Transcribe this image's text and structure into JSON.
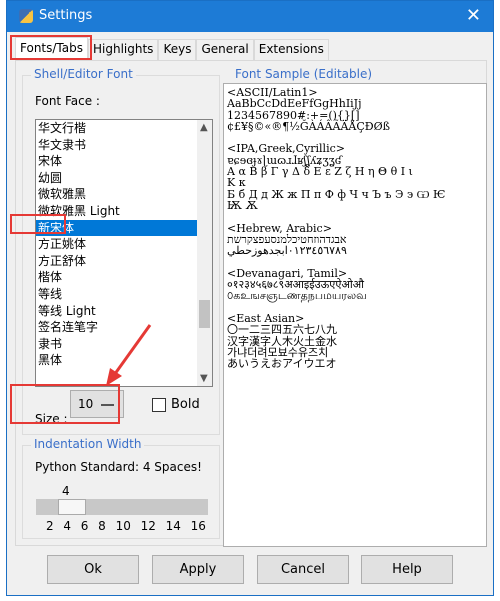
{
  "window": {
    "title": "Settings",
    "close": "✕"
  },
  "tabs": [
    "Fonts/Tabs",
    "Highlights",
    "Keys",
    "General",
    "Extensions"
  ],
  "font_group": {
    "title": "Shell/Editor Font",
    "font_face_label": "Font Face :",
    "fonts": [
      "华文行楷",
      "华文隶书",
      "宋体",
      "幼圆",
      "微软雅黑",
      "微软雅黑 Light",
      "新宋体",
      "方正姚体",
      "方正舒体",
      "楷体",
      "等线",
      "等线 Light",
      "签名连笔字",
      "隶书",
      "黑体"
    ],
    "selected_font": "新宋体",
    "size_label": "Size :",
    "size_value": "10",
    "bold_label": "Bold",
    "bold_checked": false
  },
  "indent_group": {
    "title": "Indentation Width",
    "note": "Python Standard: 4 Spaces!",
    "value_label": "4",
    "value": 4,
    "ticks": [
      "2",
      "4",
      "6",
      "8",
      "10",
      "12",
      "14",
      "16"
    ]
  },
  "sample": {
    "title": "Font Sample (Editable)",
    "text": "<ASCII/Latin1>\nAaBbCcDdEeFfGgHhIiJj\n1234567890#:+=(){}[]\n¢£¥§©«®¶½ĞÀÁÂÃÄÅÇÐØß\n\n<IPA,Greek,Cyrillic>\nɐɕɘɞɟɤɭɯɷɹɺʁʃʆʎʑʒʓʛ\nΑ α Β β Γ γ Δ δ Ε ε Ζ ζ Η η Θ θ Ι ι\nΚ κ\nБ б Д д Ж ж П п Ф ф Ч ч Ъ ъ Э э Ѡ Ѥ\nѬ Ѫ\n\n<Hebrew, Arabic>\nאבגדהוזחטיכלמנסעפצקרשת\n٠١٢٣٤٥٦٧٨٩ابجدهوزحطي\n\n<Devanagari, Tamil>\n०१२३४५६७८९अआइईउऊएऐओऔ\n௦கஉஙசஞடணதநபமயரலவ\n\n<East Asian>\n〇一二三四五六七八九\n汉字漢字人木火土金水\n가냐더려모뵤수유즈치\nあいうえおアイウエオ"
  },
  "buttons": [
    "Ok",
    "Apply",
    "Cancel",
    "Help"
  ],
  "colors": {
    "titlebar": "#1d7bd6",
    "selection": "#0078d7",
    "group_title": "#3a6fc9",
    "annotation": "#e53935"
  }
}
